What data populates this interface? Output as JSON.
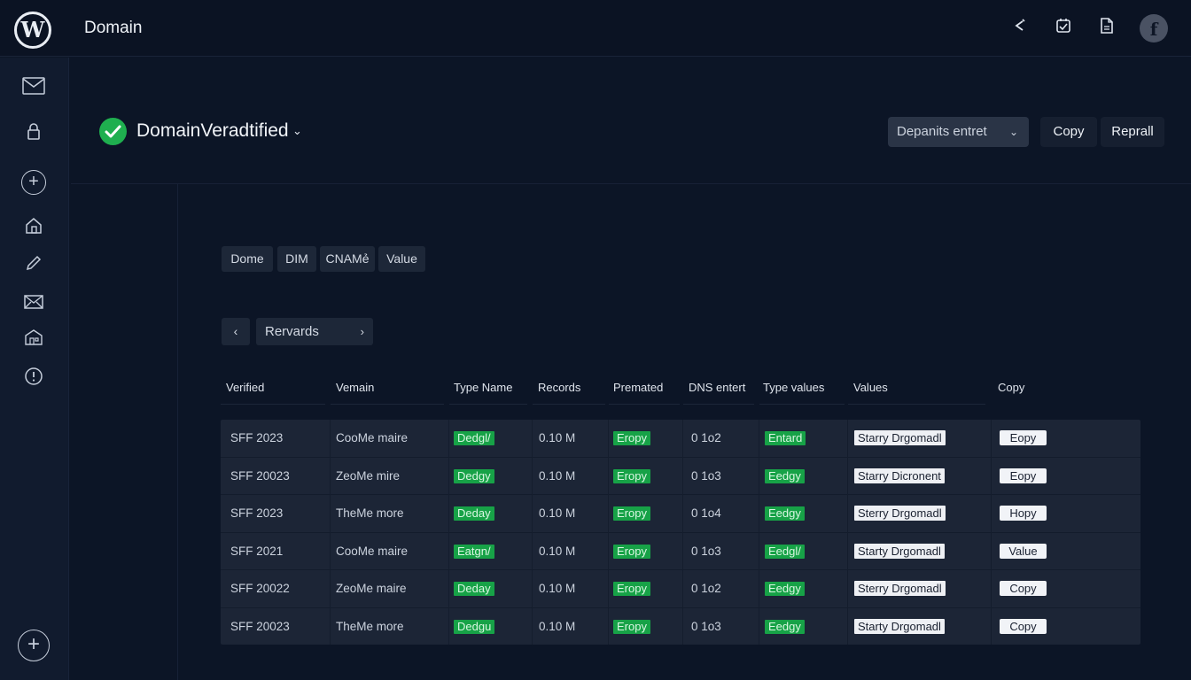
{
  "app": {
    "logo_letter": "W",
    "title": "Domain"
  },
  "topbar": {
    "icons": [
      "refresh-icon",
      "checklist-icon",
      "document-icon"
    ],
    "avatar_letter": "f"
  },
  "sidebar": {
    "items": [
      {
        "icon": "mail-icon",
        "glyph": "✉"
      },
      {
        "icon": "lock-icon",
        "glyph": "🔒︎"
      },
      {
        "icon": "add-circle-icon",
        "glyph": "+"
      },
      {
        "icon": "home-icon",
        "glyph": "⌂"
      },
      {
        "icon": "pencil-icon",
        "glyph": "✎"
      },
      {
        "icon": "envelope-icon",
        "glyph": "✉"
      },
      {
        "icon": "building-icon",
        "glyph": "⌂"
      },
      {
        "icon": "info-icon",
        "glyph": "!"
      }
    ],
    "bottom_add": "+"
  },
  "header": {
    "status": "DomainVeradtified",
    "status_chevron": "⌄",
    "dropdown_label": "Depanits entret",
    "dropdown_chevron": "⌄",
    "copy_label": "Copy",
    "repair_label": "Reprall"
  },
  "filters": [
    "Dome",
    "DIM",
    "CNAMẻ",
    "Value"
  ],
  "pager": {
    "prev": "‹",
    "label": "Rervards",
    "next": "›"
  },
  "table": {
    "headers": [
      "Verified",
      "Vemain",
      "Type Name",
      "Records",
      "Premated",
      "DNS entert",
      "Type values",
      "Values",
      "Copy"
    ],
    "rows": [
      {
        "verified": "SFF 2023",
        "domain": "CooMe maire",
        "type": "Dedgl/",
        "records": "0.10 M",
        "premated": "Eropy",
        "dns": "0 1o2",
        "type_value": "Entard",
        "value": "Starry Drgomadl",
        "action": "Eopy"
      },
      {
        "verified": "SFF 20023",
        "domain": "ZeoMe mire",
        "type": "Dedgy",
        "records": "0.10 M",
        "premated": "Eropy",
        "dns": "0 1o3",
        "type_value": "Eedgy",
        "value": "Starry Dicronent",
        "action": "Eopy"
      },
      {
        "verified": "SFF 2023",
        "domain": "TheMe more",
        "type": "Deday",
        "records": "0.10 M",
        "premated": "Eropy",
        "dns": "0 1o4",
        "type_value": "Eedgy",
        "value": "Sterry Drgomadl",
        "action": "Hopy"
      },
      {
        "verified": "SFF 2021",
        "domain": "CooMe maire",
        "type": "Eatgn/",
        "records": "0.10 M",
        "premated": "Eropy",
        "dns": "0 1o3",
        "type_value": "Eedgl/",
        "value": "Starty Drgomadl",
        "action": "Value"
      },
      {
        "verified": "SFF 20022",
        "domain": "ZeoMe maire",
        "type": "Deday",
        "records": "0.10 M",
        "premated": "Eropy",
        "dns": "0 1o2",
        "type_value": "Eedgy",
        "value": "Sterry Drgomadl",
        "action": "Copy"
      },
      {
        "verified": "SFF 20023",
        "domain": "TheMe more",
        "type": "Dedgu",
        "records": "0.10 M",
        "premated": "Eropy",
        "dns": "0 1o3",
        "type_value": "Eedgy",
        "value": "Starty Drgomadl",
        "action": "Copy"
      }
    ]
  },
  "colors": {
    "background": "#0c1526",
    "accent_green": "#1faf4f",
    "table_bg": "#1c2536"
  }
}
